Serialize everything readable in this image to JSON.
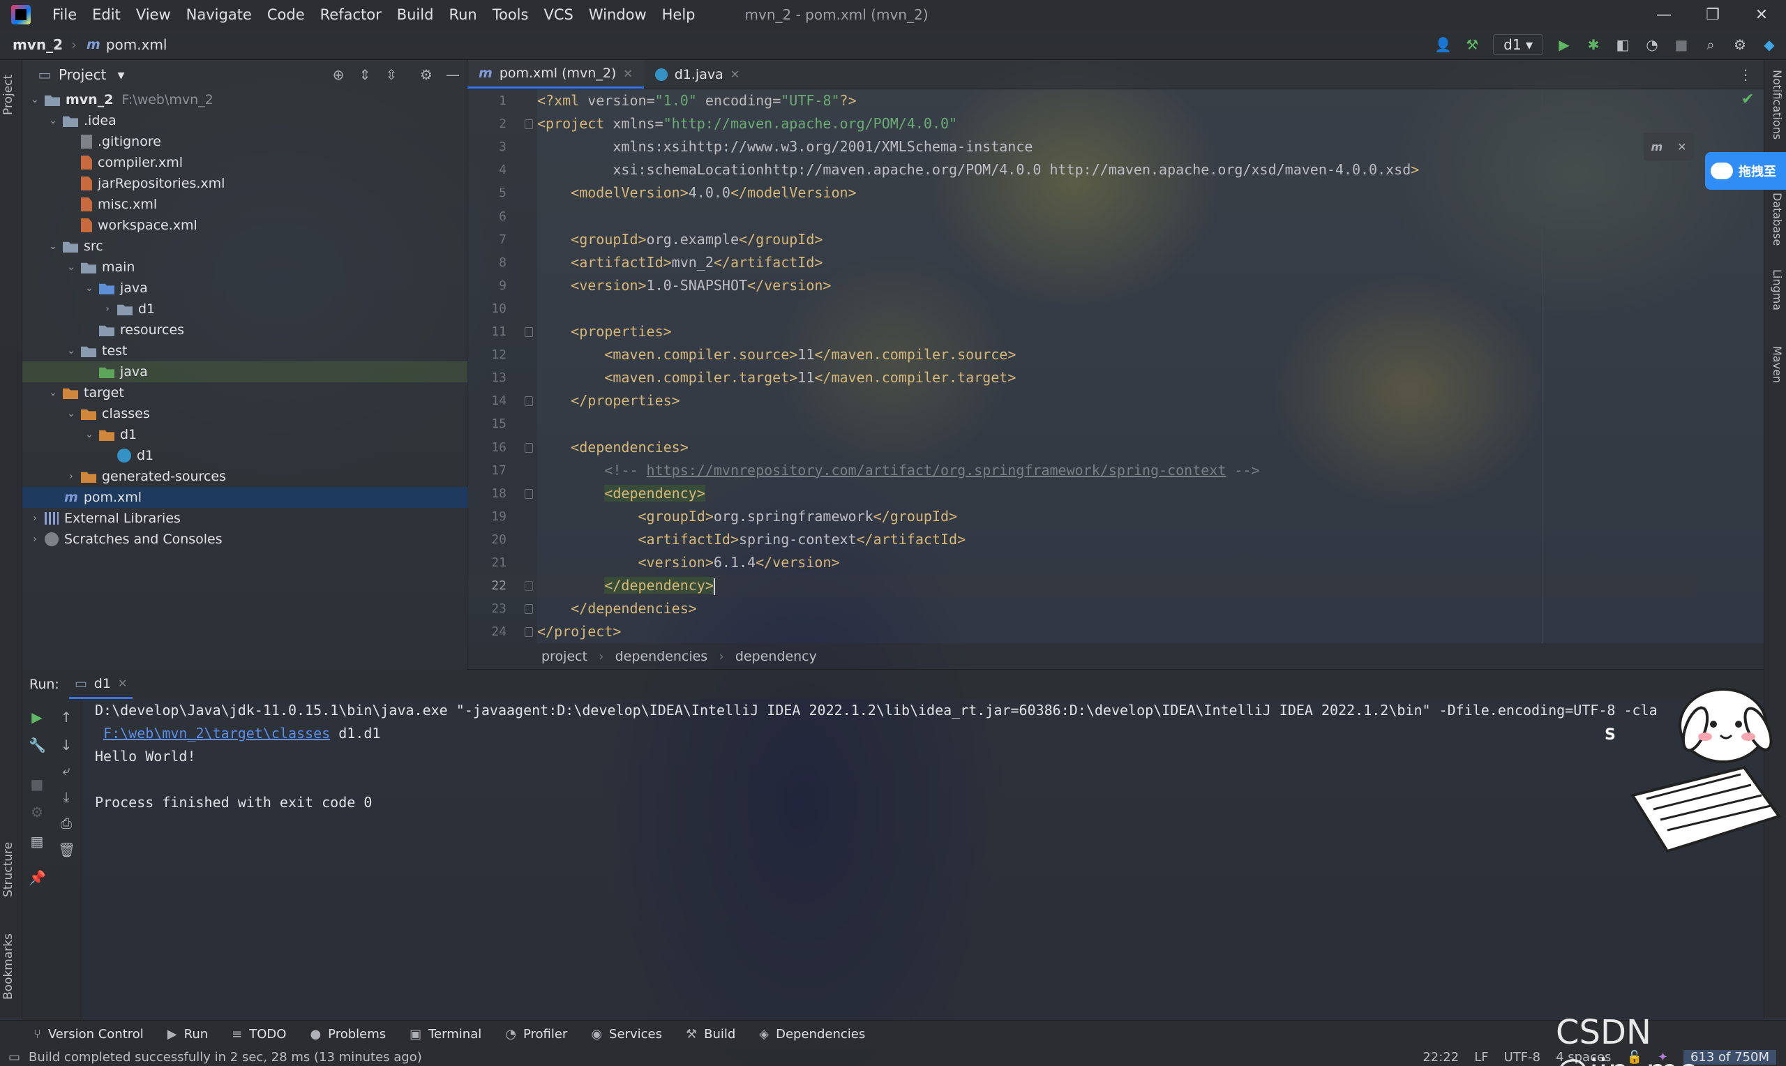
{
  "menubar": {
    "items": [
      "File",
      "Edit",
      "View",
      "Navigate",
      "Code",
      "Refactor",
      "Build",
      "Run",
      "Tools",
      "VCS",
      "Window",
      "Help"
    ],
    "title": "mvn_2 - pom.xml (mvn_2)",
    "minimize": "—",
    "maximize": "❐",
    "close": "✕"
  },
  "navbar": {
    "project": "mvn_2",
    "file": "pom.xml",
    "run_config": "d1"
  },
  "side_tabs": {
    "project": "Project",
    "structure": "Structure",
    "bookmarks": "Bookmarks",
    "notifications": "Notifications",
    "database": "Database",
    "lingma": "Lingma",
    "maven": "Maven"
  },
  "project_panel": {
    "title": "Project",
    "tree": [
      {
        "label": "mvn_2",
        "path": "F:\\web\\mvn_2",
        "indent": 0,
        "arrow": "⌄",
        "icon": "folder"
      },
      {
        "label": ".idea",
        "indent": 1,
        "arrow": "⌄",
        "icon": "folder"
      },
      {
        "label": ".gitignore",
        "indent": 2,
        "arrow": "",
        "icon": "git"
      },
      {
        "label": "compiler.xml",
        "indent": 2,
        "arrow": "",
        "icon": "xml"
      },
      {
        "label": "jarRepositories.xml",
        "indent": 2,
        "arrow": "",
        "icon": "xml"
      },
      {
        "label": "misc.xml",
        "indent": 2,
        "arrow": "",
        "icon": "xml"
      },
      {
        "label": "workspace.xml",
        "indent": 2,
        "arrow": "",
        "icon": "xml"
      },
      {
        "label": "src",
        "indent": 1,
        "arrow": "⌄",
        "icon": "folder"
      },
      {
        "label": "main",
        "indent": 2,
        "arrow": "⌄",
        "icon": "folder"
      },
      {
        "label": "java",
        "indent": 3,
        "arrow": "⌄",
        "icon": "folder-blue"
      },
      {
        "label": "d1",
        "indent": 4,
        "arrow": "›",
        "icon": "folder"
      },
      {
        "label": "resources",
        "indent": 3,
        "arrow": "",
        "icon": "folder"
      },
      {
        "label": "test",
        "indent": 2,
        "arrow": "⌄",
        "icon": "folder"
      },
      {
        "label": "java",
        "indent": 3,
        "arrow": "",
        "icon": "folder-green"
      },
      {
        "label": "target",
        "indent": 1,
        "arrow": "⌄",
        "icon": "folder-orange"
      },
      {
        "label": "classes",
        "indent": 2,
        "arrow": "⌄",
        "icon": "folder-orange"
      },
      {
        "label": "d1",
        "indent": 3,
        "arrow": "⌄",
        "icon": "folder-orange"
      },
      {
        "label": "d1",
        "indent": 4,
        "arrow": "",
        "icon": "class"
      },
      {
        "label": "generated-sources",
        "indent": 2,
        "arrow": "›",
        "icon": "folder-orange"
      },
      {
        "label": "pom.xml",
        "indent": 1,
        "arrow": "",
        "icon": "maven"
      },
      {
        "label": "External Libraries",
        "indent": 0,
        "arrow": "›",
        "icon": "lib"
      },
      {
        "label": "Scratches and Consoles",
        "indent": 0,
        "arrow": "›",
        "icon": "scratch"
      }
    ]
  },
  "tabs": [
    {
      "label": "pom.xml (mvn_2)",
      "icon": "m",
      "active": true
    },
    {
      "label": "d1.java",
      "icon": "c",
      "active": false
    }
  ],
  "editor": {
    "current_line": 22,
    "line_numbers": [
      "1",
      "2",
      "3",
      "4",
      "5",
      "6",
      "7",
      "8",
      "9",
      "10",
      "11",
      "12",
      "13",
      "14",
      "15",
      "16",
      "17",
      "18",
      "19",
      "20",
      "21",
      "22",
      "23",
      "24"
    ],
    "lines": [
      "<?xml version=\"1.0\" encoding=\"UTF-8\"?>",
      "<project xmlns=\"http://maven.apache.org/POM/4.0.0\"",
      "         xmlns:xsi=\"http://www.w3.org/2001/XMLSchema-instance\"",
      "         xsi:schemaLocation=\"http://maven.apache.org/POM/4.0.0 http://maven.apache.org/xsd/maven-4.0.0.xsd\">",
      "    <modelVersion>4.0.0</modelVersion>",
      "",
      "    <groupId>org.example</groupId>",
      "    <artifactId>mvn_2</artifactId>",
      "    <version>1.0-SNAPSHOT</version>",
      "",
      "    <properties>",
      "        <maven.compiler.source>11</maven.compiler.source>",
      "        <maven.compiler.target>11</maven.compiler.target>",
      "    </properties>",
      "",
      "    <dependencies>",
      "        <!-- https://mvnrepository.com/artifact/org.springframework/spring-context -->",
      "        <dependency>",
      "            <groupId>org.springframework</groupId>",
      "            <artifactId>spring-context</artifactId>",
      "            <version>6.1.4</version>",
      "        </dependency>",
      "    </dependencies>",
      "</project>"
    ],
    "breadcrumbs": [
      "project",
      "dependencies",
      "dependency"
    ]
  },
  "run_panel": {
    "label": "Run:",
    "config": "d1",
    "console": [
      {
        "text": "D:\\develop\\Java\\jdk-11.0.15.1\\bin\\java.exe \"-javaagent:D:\\develop\\IDEA\\IntelliJ IDEA 2022.1.2\\lib\\idea_rt.jar=60386:D:\\develop\\IDEA\\IntelliJ IDEA 2022.1.2\\bin\" -Dfile.encoding=UTF-8 -cla"
      },
      {
        "link": "F:\\web\\mvn_2\\target\\classes",
        "text": " d1.d1"
      },
      {
        "text": "Hello World!"
      },
      {
        "text": ""
      },
      {
        "text": "Process finished with exit code 0"
      }
    ]
  },
  "toolwindows": [
    {
      "label": "Version Control",
      "icon": "⑂"
    },
    {
      "label": "Run",
      "icon": "▶"
    },
    {
      "label": "TODO",
      "icon": "≡"
    },
    {
      "label": "Problems",
      "icon": "●"
    },
    {
      "label": "Terminal",
      "icon": "▣"
    },
    {
      "label": "Profiler",
      "icon": "◔"
    },
    {
      "label": "Services",
      "icon": "◉"
    },
    {
      "label": "Build",
      "icon": "⚒"
    },
    {
      "label": "Dependencies",
      "icon": "◈"
    }
  ],
  "status": {
    "message": "Build completed successfully in 2 sec, 28 ms (13 minutes ago)",
    "position": "22:22",
    "line_sep": "LF",
    "encoding": "UTF-8",
    "indent": "4 spaces",
    "memory": "613 of 750M"
  },
  "overlay": {
    "watermark": "CSDN @jin_mo",
    "baidu_label": "拖拽至",
    "mvn_popup_icon": "m",
    "sticker_letter": "S"
  },
  "colors": {
    "accent": "#3574f0",
    "tag": "#d5b778",
    "attr_value": "#6aab73",
    "link": "#5c8fe6",
    "selection": "#1e3a5f"
  }
}
